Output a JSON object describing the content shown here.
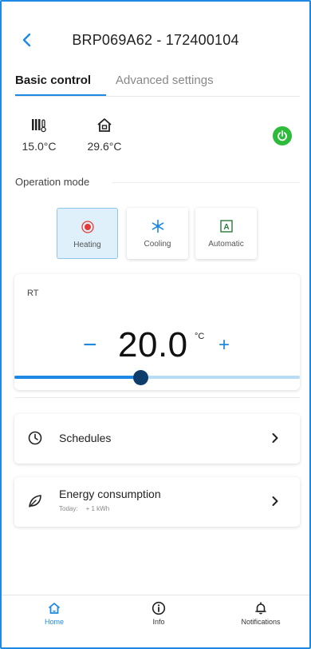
{
  "header": {
    "title": "BRP069A62 - 172400104",
    "back_icon": "chevron-left-icon"
  },
  "tabs": [
    {
      "label": "Basic control",
      "active": true
    },
    {
      "label": "Advanced settings",
      "active": false
    }
  ],
  "temperatures": {
    "indoor": {
      "icon": "indoor-thermometer-icon",
      "value": "15.0°C"
    },
    "outdoor": {
      "icon": "outdoor-house-icon",
      "value": "29.6°C"
    }
  },
  "power": {
    "icon": "power-icon",
    "on": true,
    "color": "#2dbb3a"
  },
  "operation_mode": {
    "label": "Operation mode",
    "modes": [
      {
        "label": "Heating",
        "icon": "heating-icon",
        "active": true
      },
      {
        "label": "Cooling",
        "icon": "cooling-snowflake-icon",
        "active": false
      },
      {
        "label": "Automatic",
        "icon": "automatic-icon",
        "active": false
      }
    ]
  },
  "rt": {
    "label": "RT",
    "minus": "−",
    "plus": "+",
    "setpoint": "20.0",
    "unit": "°C",
    "slider_level": 0.44
  },
  "cards": {
    "schedules": {
      "title": "Schedules",
      "icon": "clock-icon"
    },
    "energy": {
      "title": "Energy consumption",
      "icon": "leaf-icon",
      "sub_label": "Today:",
      "sub_value": "+ 1 kWh"
    }
  },
  "nav": [
    {
      "label": "Home",
      "icon": "home-icon",
      "active": true
    },
    {
      "label": "Info",
      "icon": "info-icon",
      "active": false
    },
    {
      "label": "Notifications",
      "icon": "bell-icon",
      "active": false
    }
  ],
  "colors": {
    "accent": "#1e88e5",
    "active_mode_bg": "#dff0fa",
    "heating_red": "#e53935",
    "power_green": "#2dbb3a"
  }
}
